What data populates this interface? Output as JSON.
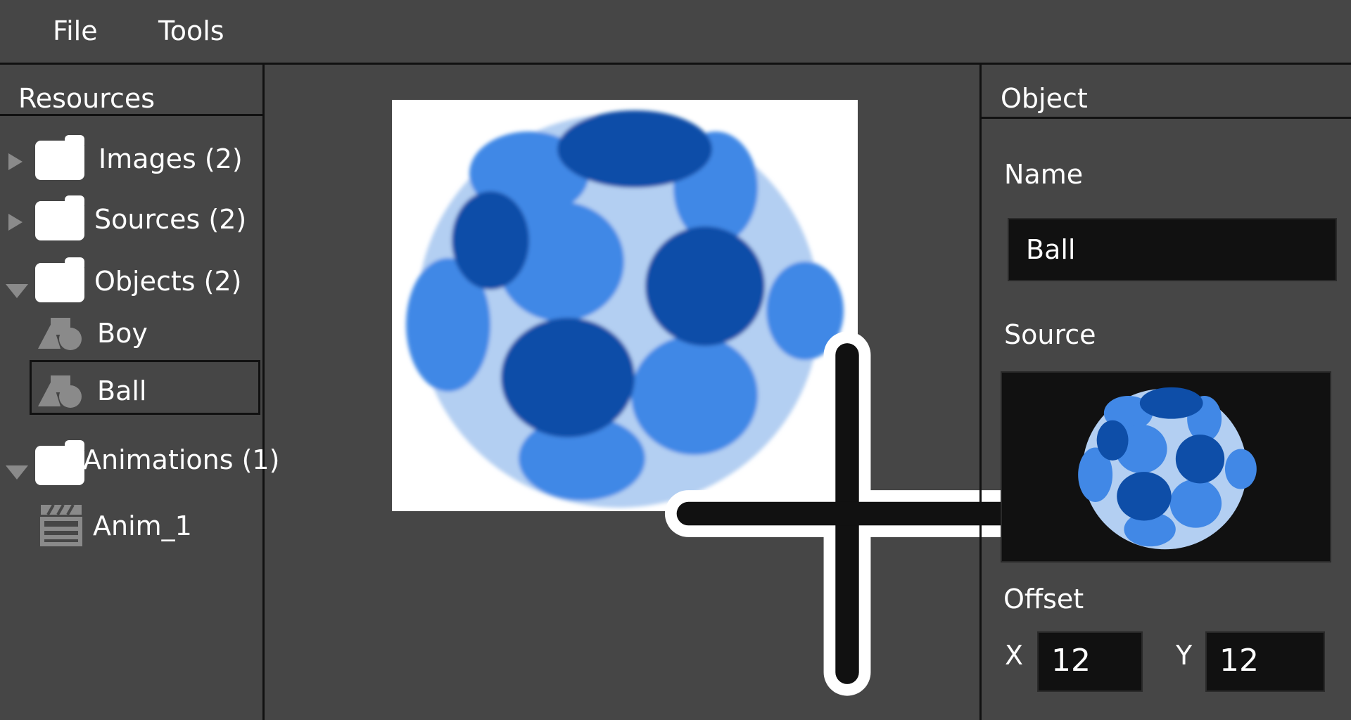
{
  "menu": {
    "file": "File",
    "tools": "Tools"
  },
  "resources": {
    "header": "Resources",
    "folders": [
      {
        "label": "Images (2)",
        "expanded": false
      },
      {
        "label": "Sources (2)",
        "expanded": false
      },
      {
        "label": "Objects (2)",
        "expanded": true
      },
      {
        "label": "Animations (1)",
        "expanded": true
      }
    ],
    "objects": [
      {
        "label": "Boy",
        "selected": false
      },
      {
        "label": "Ball",
        "selected": true
      }
    ],
    "animations": [
      {
        "label": "Anim_1"
      }
    ]
  },
  "object_panel": {
    "header": "Object",
    "name_label": "Name",
    "name_value": "Ball",
    "source_label": "Source",
    "offset_label": "Offset",
    "x_label": "X",
    "x_value": "12",
    "y_label": "Y",
    "y_value": "12"
  },
  "icons": {
    "folder": "folder-icon",
    "expand": "chevron-right-icon",
    "collapse": "chevron-down-icon",
    "object": "shapes-icon",
    "animation": "clapperboard-icon",
    "crosshair": "crosshair-icon"
  },
  "colors": {
    "background": "#464646",
    "input_bg": "#111111",
    "ball_light": "#b3cff2",
    "ball_mid": "#4188e6",
    "ball_dark": "#0e4ea8"
  }
}
